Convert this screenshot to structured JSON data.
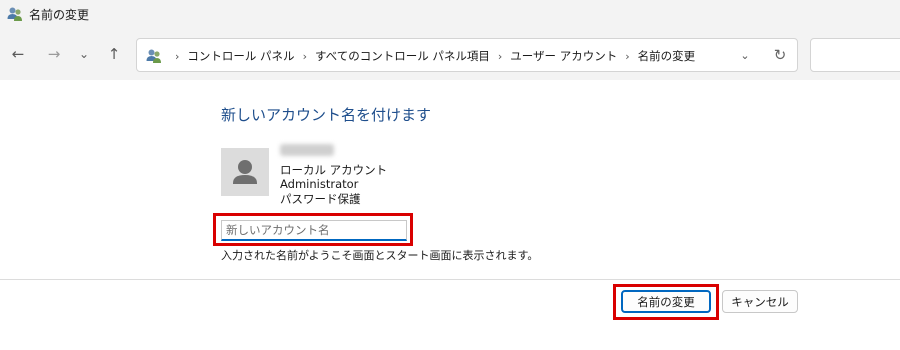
{
  "window": {
    "title": "名前の変更"
  },
  "nav": {
    "back_glyph": "←",
    "forward_glyph": "→",
    "recent_glyph": "⌄",
    "up_glyph": "↑"
  },
  "address": {
    "crumbs": [
      "コントロール パネル",
      "すべてのコントロール パネル項目",
      "ユーザー アカウント",
      "名前の変更"
    ],
    "separator": "›",
    "dropdown_glyph": "⌄",
    "refresh_glyph": "↻"
  },
  "main": {
    "heading": "新しいアカウント名を付けます",
    "account": {
      "type": "ローカル アカウント",
      "role": "Administrator",
      "password": "パスワード保護"
    },
    "new_name": {
      "placeholder": "新しいアカウント名",
      "value": ""
    },
    "hint": "入力された名前がようこそ画面とスタート画面に表示されます。"
  },
  "footer": {
    "rename_label": "名前の変更",
    "cancel_label": "キャンセル"
  },
  "colors": {
    "accent": "#0067c0",
    "heading": "#1e4e8c",
    "highlight": "#d90000"
  },
  "icons": {
    "title": "user-accounts-icon",
    "address": "user-accounts-icon",
    "avatar": "user-avatar-icon"
  }
}
